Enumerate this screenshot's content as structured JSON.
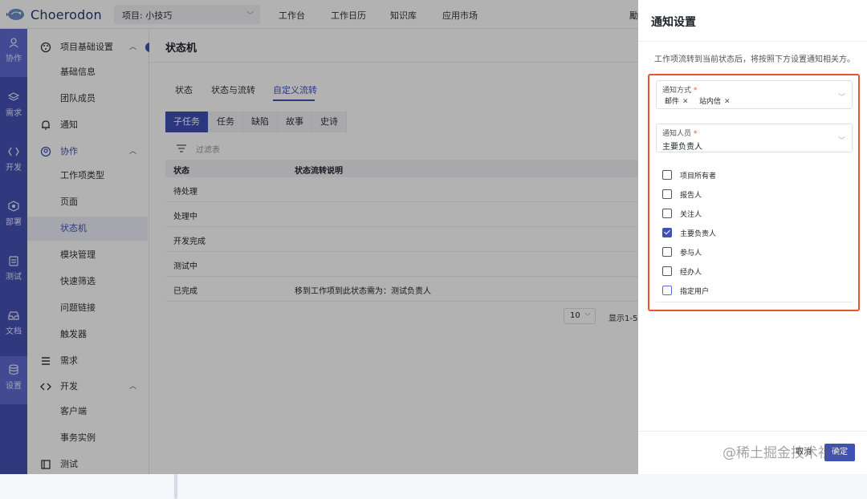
{
  "topbar": {
    "logo_text": "Choerodon",
    "project": "项目: 小技巧",
    "nav": [
      "工作台",
      "工作日历",
      "知识库",
      "应用市场"
    ],
    "right_peek": "勵"
  },
  "rail": [
    "协作",
    "需求",
    "开发",
    "部署",
    "测试",
    "文档",
    "设置"
  ],
  "menu": {
    "items": [
      {
        "label": "项目基础设置",
        "type": "group",
        "icon": "palette-icon"
      },
      {
        "label": "基础信息",
        "type": "sub"
      },
      {
        "label": "团队成员",
        "type": "sub"
      },
      {
        "label": "通知",
        "type": "group",
        "icon": "bell-icon"
      },
      {
        "label": "协作",
        "type": "group",
        "icon": "collab-icon"
      },
      {
        "label": "工作项类型",
        "type": "sub"
      },
      {
        "label": "页面",
        "type": "sub"
      },
      {
        "label": "状态机",
        "type": "sub",
        "active": true
      },
      {
        "label": "模块管理",
        "type": "sub"
      },
      {
        "label": "快速筛选",
        "type": "sub"
      },
      {
        "label": "问题链接",
        "type": "sub"
      },
      {
        "label": "触发器",
        "type": "sub"
      },
      {
        "label": "需求",
        "type": "group",
        "icon": "list-icon"
      },
      {
        "label": "开发",
        "type": "group",
        "icon": "code-icon"
      },
      {
        "label": "客户端",
        "type": "sub"
      },
      {
        "label": "事务实例",
        "type": "sub"
      },
      {
        "label": "测试",
        "type": "group",
        "icon": "test-icon"
      }
    ]
  },
  "main": {
    "title": "状态机",
    "tabs": [
      "状态",
      "状态与流转",
      "自定义流转"
    ],
    "segments": [
      "子任务",
      "任务",
      "缺陷",
      "故事",
      "史诗"
    ],
    "filter_placeholder": "过滤表",
    "columns": [
      "状态",
      "状态流转说明"
    ],
    "rows": [
      {
        "status": "待处理",
        "desc": ""
      },
      {
        "status": "处理中",
        "desc": ""
      },
      {
        "status": "开发完成",
        "desc": ""
      },
      {
        "status": "测试中",
        "desc": ""
      },
      {
        "status": "已完成",
        "desc": "移到工作项到此状态需为：测试负责人"
      }
    ],
    "page_size": "10",
    "pager_text": "显示1-5"
  },
  "drawer": {
    "title": "通知设置",
    "desc": "工作项流转到当前状态后，将按照下方设置通知相关方。",
    "method_label": "通知方式",
    "method_chips": [
      "邮件",
      "站内信"
    ],
    "people_label": "通知人员",
    "people_value": "主要负责人",
    "options": [
      {
        "label": "项目所有者",
        "checked": false
      },
      {
        "label": "报告人",
        "checked": false
      },
      {
        "label": "关注人",
        "checked": false
      },
      {
        "label": "主要负责人",
        "checked": true
      },
      {
        "label": "参与人",
        "checked": false
      },
      {
        "label": "经办人",
        "checked": false
      },
      {
        "label": "指定用户",
        "checked": false
      }
    ],
    "cancel": "取消",
    "ok": "确定"
  },
  "watermark": "@稀土掘金技术社区",
  "colors": {
    "primary": "#3f51b5",
    "rail": "#4652b5",
    "highlight": "#e4572e"
  }
}
